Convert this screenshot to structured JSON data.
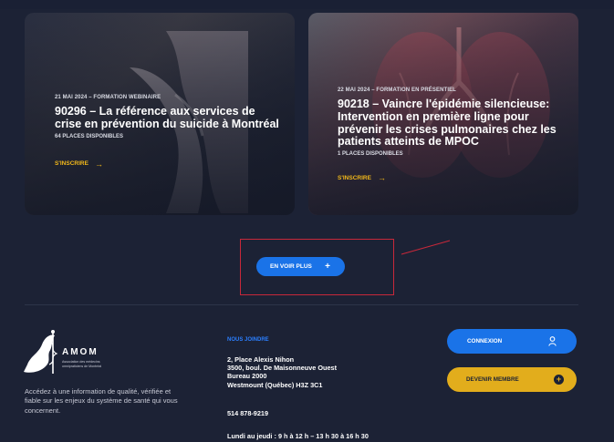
{
  "cards": [
    {
      "meta": "21 MAI 2024 – FORMATION WEBINAIRE",
      "title": "90296 – La référence aux services de crise en prévention du suicide à Montréal",
      "places": "64 PLACES DISPONIBLES",
      "cta": "S'INSCRIRE",
      "arrow": "→"
    },
    {
      "meta": "22 MAI 2024 – FORMATION EN PRÉSENTIEL",
      "title": "90218 – Vaincre l'épidémie silencieuse: Intervention en première ligne pour prévenir les crises pulmonaires chez les patients atteints de MPOC",
      "places": "1 PLACES DISPONIBLES",
      "cta": "S'INSCRIRE",
      "arrow": "→"
    }
  ],
  "see_more": {
    "label": "EN VOIR PLUS",
    "icon": "+"
  },
  "footer": {
    "logo_name": "AMOM",
    "logo_subtitle": "Association des médecins omnipraticiens de Montréal",
    "tagline": "Accédez à une information de qualité, vérifiée et fiable sur les enjeux du système de santé qui vous concernent.",
    "contact_heading": "NOUS JOINDRE",
    "address": [
      "2, Place Alexis Nihon",
      "3500, boul. De Maisonneuve Ouest",
      "Bureau 2000",
      "Westmount (Québec) H3Z 3C1"
    ],
    "phone": "514 878-9219",
    "hours": "Lundi au jeudi : 9 h à 12 h – 13 h 30 à 16 h 30",
    "login_label": "CONNEXION",
    "member_label": "DEVENIR MEMBRE",
    "member_icon": "+"
  },
  "colors": {
    "background": "#1c2235",
    "accent_blue": "#1a73e8",
    "accent_gold": "#e2ad1c",
    "annotation_red": "#c8283a"
  }
}
